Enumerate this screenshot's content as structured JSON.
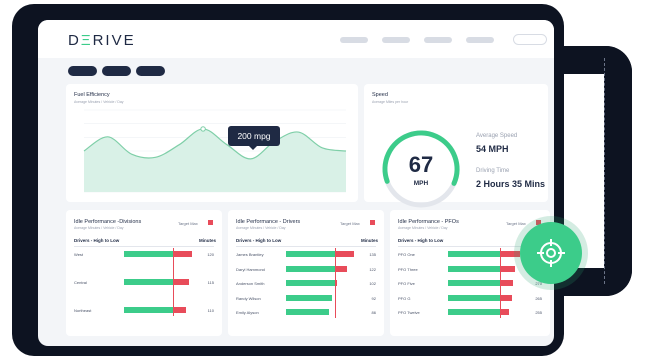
{
  "app": {
    "logo_pre": "D",
    "logo_mark": "Ξ",
    "logo_post": "RIVE"
  },
  "fuel": {
    "title": "Fuel Efficiency",
    "subtitle": "Average Minutes / Vehicle / Day",
    "tooltip": "200 mpg"
  },
  "speed": {
    "title": "Speed",
    "subtitle": "Average Miles per hour",
    "gauge_value": "67",
    "gauge_unit": "MPH",
    "avg_label": "Average Speed",
    "avg_value": "54 MPH",
    "time_label": "Driving Time",
    "time_value": "2 Hours 35 Mins"
  },
  "panels": [
    {
      "title": "Idle Performance -Divisions",
      "subtitle": "Average Minutes / Vehicle / Day",
      "target_label": "Target Max",
      "col_left": "Drivers - High to Low",
      "col_right": "Minutes",
      "rows": [
        {
          "label": "West",
          "value": "120"
        },
        {
          "label": "Central",
          "value": "115"
        },
        {
          "label": "Northeast",
          "value": "110"
        }
      ]
    },
    {
      "title": "Idle Performance - Drivers",
      "subtitle": "Average Minutes / Vehicle / Day",
      "target_label": "Target Max",
      "col_left": "Drivers - High to Low",
      "col_right": "Minutes",
      "rows": [
        {
          "label": "James Brantley",
          "value": "135"
        },
        {
          "label": "Daryl Hammond",
          "value": "122"
        },
        {
          "label": "Anderson Smith",
          "value": "102"
        },
        {
          "label": "Randy Wilson",
          "value": "92"
        },
        {
          "label": "Emily Alyson",
          "value": "86"
        }
      ]
    },
    {
      "title": "Idle Performance - PFOs",
      "subtitle": "Average Minutes / Vehicle / Day",
      "target_label": "Target Max",
      "col_left": "Drivers - High to Low",
      "col_right": "Minutes",
      "rows": [
        {
          "label": "PFO One",
          "value": "300"
        },
        {
          "label": "PFO Three",
          "value": "280"
        },
        {
          "label": "PFO Five",
          "value": "270"
        },
        {
          "label": "PFO G",
          "value": "265"
        },
        {
          "label": "PFO Twelve",
          "value": "255"
        }
      ]
    }
  ],
  "chart_data": {
    "type": "area",
    "title": "Fuel Efficiency",
    "values": [
      130,
      175,
      120,
      110,
      150,
      200,
      150,
      105,
      160,
      190,
      140,
      130
    ],
    "ylim": [
      0,
      260
    ]
  },
  "colors": {
    "accent": "#3ccc8a",
    "alert": "#e84c5a",
    "navy": "#1f2a44"
  },
  "icons": {
    "fab": "crosshair-target-icon"
  }
}
